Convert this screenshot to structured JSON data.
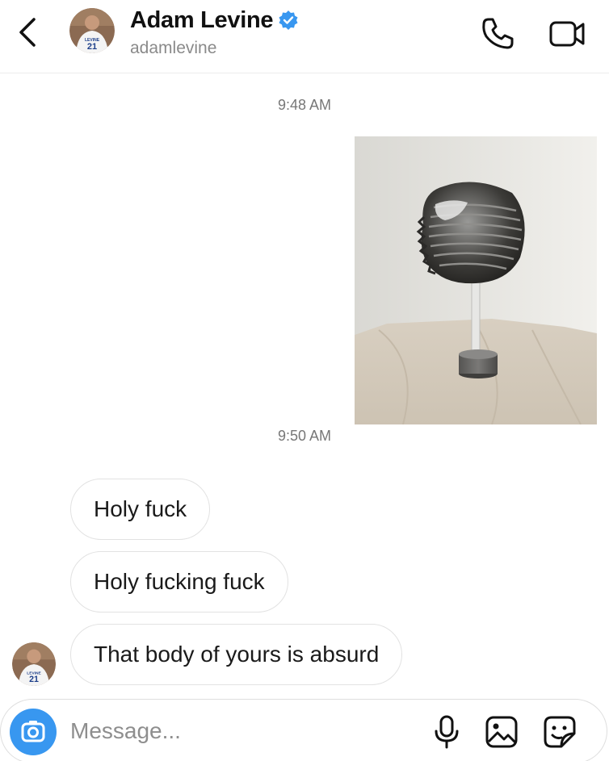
{
  "header": {
    "display_name": "Adam Levine",
    "username": "adamlevine",
    "verified": true,
    "avatar_jersey_name": "LEVINE",
    "avatar_jersey_number": "21",
    "icons": {
      "back": "chevron-left-icon",
      "call": "phone-icon",
      "video": "video-camera-icon",
      "verified": "verified-badge-icon"
    }
  },
  "thread": {
    "timestamps": [
      "9:48 AM",
      "9:50 AM"
    ],
    "photo_message": {
      "description_icon": "sculpture-photo"
    },
    "messages": [
      {
        "sender": "adamlevine",
        "text": "Holy fuck"
      },
      {
        "sender": "adamlevine",
        "text": "Holy fucking fuck"
      },
      {
        "sender": "adamlevine",
        "text": "That body of yours is absurd"
      }
    ]
  },
  "composer": {
    "placeholder": "Message...",
    "value": "",
    "icons": {
      "camera": "camera-icon",
      "mic": "microphone-icon",
      "gallery": "gallery-icon",
      "sticker": "sticker-icon"
    }
  },
  "colors": {
    "accent": "#3897f0",
    "verified": "#3897f0",
    "secondary_text": "#8a8a8a",
    "bubble_border": "#e2e2e2"
  }
}
